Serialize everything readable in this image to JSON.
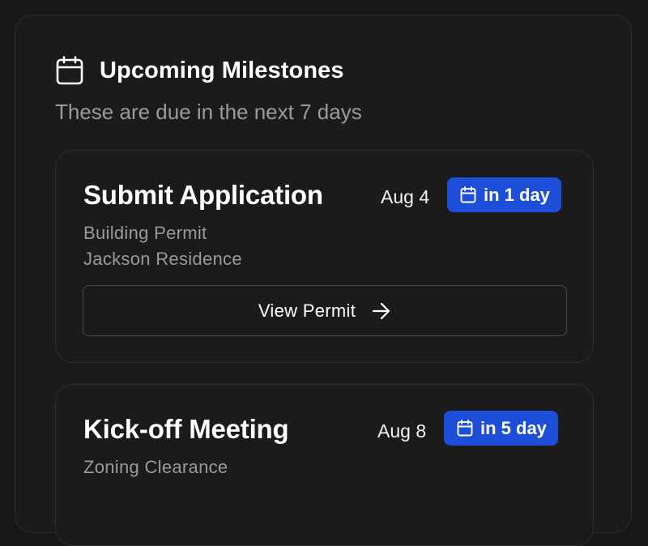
{
  "widget": {
    "title": "Upcoming Milestones",
    "subtitle": "These are due in the next 7 days"
  },
  "milestones": [
    {
      "title": "Submit Application",
      "date": "Aug 4",
      "badge": "in 1 day",
      "permit_type": "Building Permit",
      "project": "Jackson Residence",
      "action_label": "View Permit"
    },
    {
      "title": "Kick-off Meeting",
      "date": "Aug 8",
      "badge": "in 5 day",
      "permit_type": "Zoning Clearance"
    }
  ],
  "colors": {
    "background": "#181818",
    "badge": "#1d4ed8",
    "muted_text": "#9a9a9a"
  },
  "icons": {
    "header": "calendar-icon",
    "badge": "calendar-icon",
    "action": "arrow-right-icon"
  }
}
